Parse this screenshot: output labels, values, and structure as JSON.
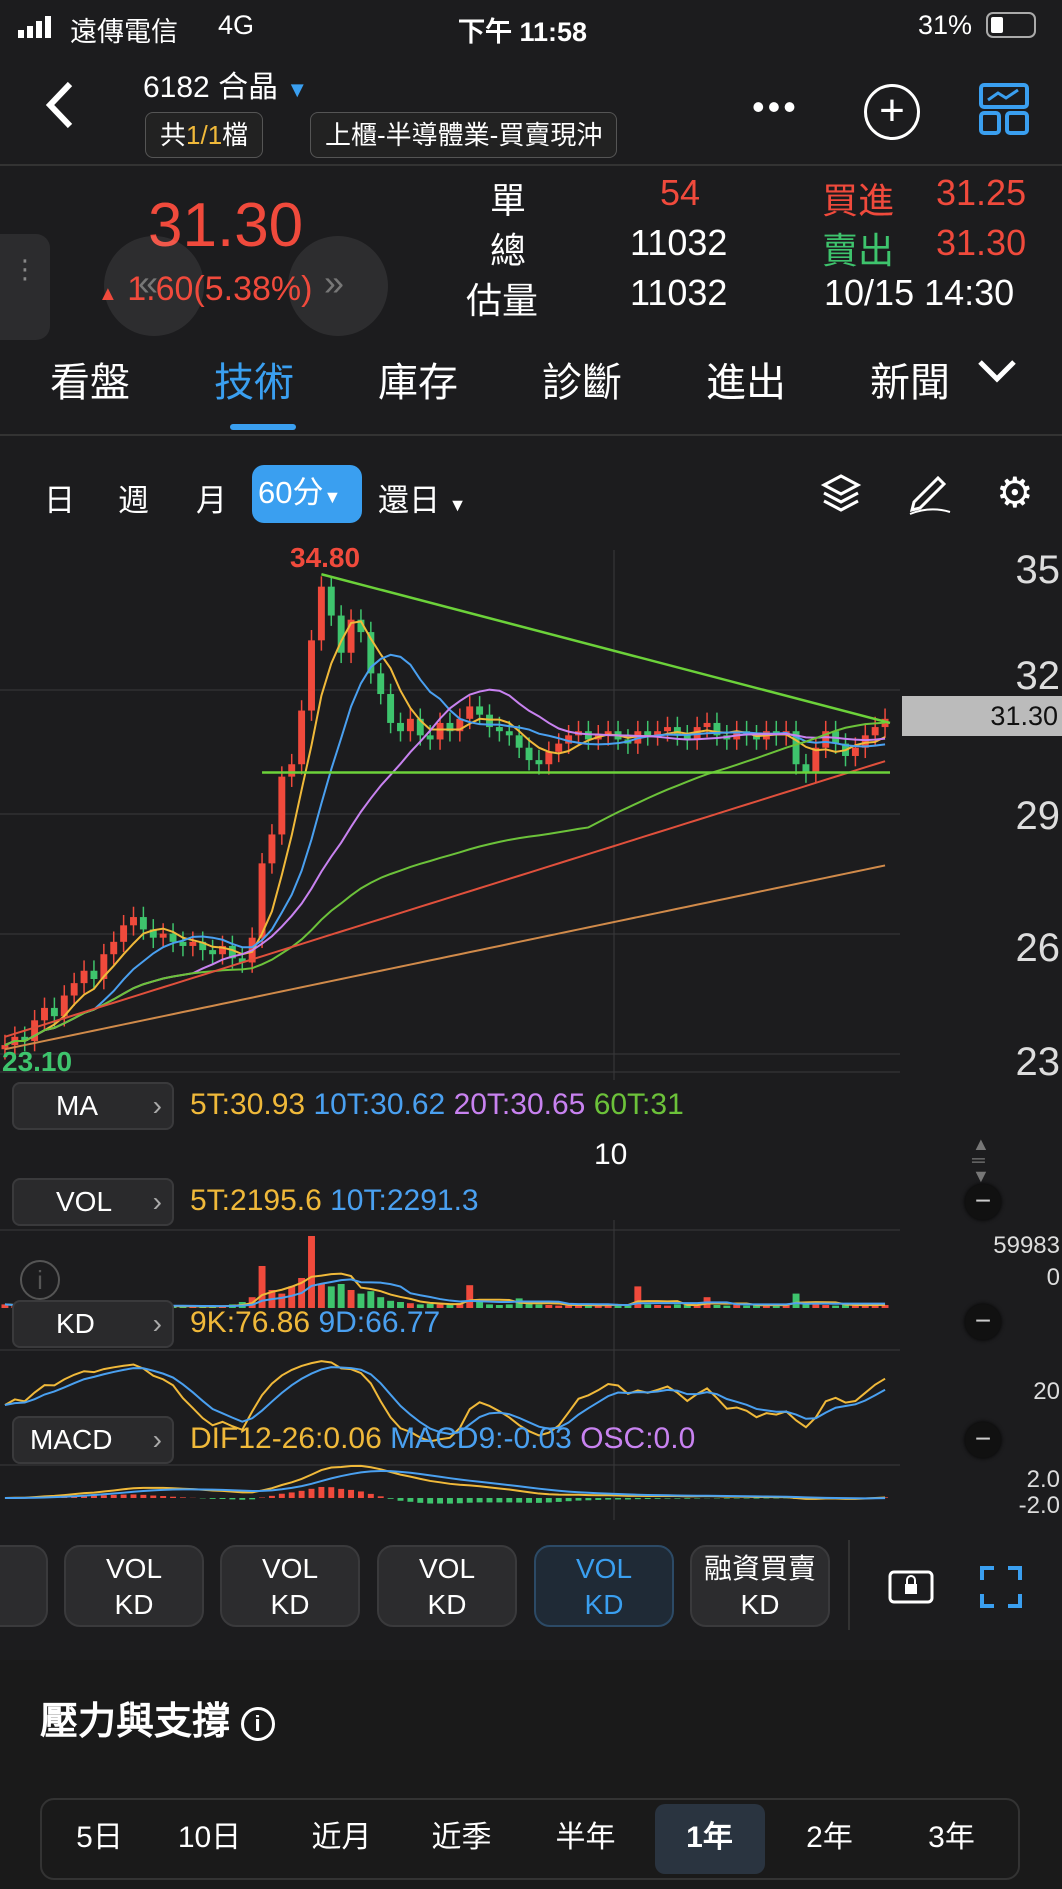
{
  "status": {
    "carrier": "遠傳電信",
    "network": "4G",
    "time": "下午 11:58",
    "battery": "31%"
  },
  "header": {
    "title": "6182 合晶",
    "file_prefix": "共",
    "file_count": "1/1",
    "file_suffix": "檔",
    "market": "上櫃-半導體業-買賣現沖"
  },
  "quote": {
    "price": "31.30",
    "change": "1.60(5.38%)",
    "labels": {
      "single": "單",
      "total": "總",
      "est": "估量",
      "bid": "買進",
      "ask": "賣出"
    },
    "single": "54",
    "total": "11032",
    "est": "11032",
    "bid": "31.25",
    "ask": "31.30",
    "datetime": "10/15 14:30"
  },
  "tabs": [
    "看盤",
    "技術",
    "庫存",
    "診斷",
    "進出",
    "新聞"
  ],
  "toolbar": {
    "periods": [
      "日",
      "週",
      "月",
      "60分"
    ],
    "adjust": "還日"
  },
  "chart_labels": {
    "high": "34.80",
    "low": "23.10",
    "current": "31.30",
    "x_tick": "10",
    "price_ticks": [
      "35",
      "32",
      "29",
      "26",
      "23"
    ],
    "vol_ticks": [
      "59983",
      "0"
    ],
    "kd_tick": "20",
    "macd_ticks": [
      "2.0",
      "-2.0"
    ]
  },
  "ma": {
    "label": "MA",
    "v5": "5T:30.93",
    "v10": "10T:30.62",
    "v20": "20T:30.65",
    "v60": "60T:31"
  },
  "vol": {
    "label": "VOL",
    "v5": "5T:2195.6",
    "v10": "10T:2291.3"
  },
  "kd": {
    "label": "KD",
    "k": "9K:76.86",
    "d": "9D:66.77"
  },
  "macd": {
    "label": "MACD",
    "dif": "DIF12-26:0.06",
    "macd": "MACD9:-0.03",
    "osc": "OSC:0.0"
  },
  "presets": [
    {
      "a": "VOL",
      "b": "KD"
    },
    {
      "a": "VOL",
      "b": "KD"
    },
    {
      "a": "VOL",
      "b": "KD"
    },
    {
      "a": "VOL",
      "b": "KD"
    },
    {
      "a": "融資買賣",
      "b": "KD"
    }
  ],
  "section": {
    "title": "壓力與支撐",
    "periods": [
      "5日",
      "10日",
      "近月",
      "近季",
      "半年",
      "1年",
      "2年",
      "3年"
    ],
    "active": "1年"
  },
  "colors": {
    "up": "#f04a3c",
    "down": "#3ec46d",
    "accent": "#3a9ff0",
    "ma5": "#f0b93a",
    "ma10": "#4aa0f0",
    "ma20": "#c882f0",
    "ma60": "#6cc23a"
  },
  "chart_data": {
    "type": "candlestick",
    "ylim": [
      23,
      35
    ],
    "closes": [
      23.4,
      23.6,
      23.5,
      24.0,
      24.3,
      24.1,
      24.6,
      24.9,
      25.2,
      25.0,
      25.6,
      25.9,
      26.3,
      26.5,
      26.2,
      26.0,
      26.1,
      25.9,
      25.8,
      25.9,
      25.7,
      25.6,
      25.8,
      25.5,
      25.4,
      26.0,
      27.8,
      28.5,
      29.9,
      30.2,
      31.5,
      33.2,
      34.5,
      33.8,
      32.9,
      33.7,
      33.4,
      32.4,
      31.9,
      31.2,
      31.0,
      31.3,
      30.9,
      30.8,
      31.2,
      31.0,
      31.3,
      31.6,
      31.4,
      31.1,
      31.0,
      30.9,
      30.6,
      30.3,
      30.2,
      30.5,
      30.7,
      30.9,
      31.0,
      30.8,
      30.9,
      31.0,
      30.8,
      30.7,
      31.0,
      30.9,
      31.0,
      31.1,
      30.9,
      30.8,
      31.1,
      31.2,
      30.9,
      30.8,
      31.0,
      30.9,
      30.8,
      31.0,
      30.9,
      31.0,
      30.2,
      30.0,
      30.6,
      31.0,
      30.7,
      30.4,
      30.6,
      30.9,
      31.1,
      31.3
    ],
    "volumes": [
      300,
      200,
      150,
      250,
      200,
      150,
      300,
      200,
      150,
      200,
      250,
      200,
      300,
      200,
      150,
      200,
      150,
      100,
      150,
      120,
      100,
      150,
      200,
      300,
      500,
      900,
      3500,
      1500,
      1200,
      1800,
      2500,
      5998,
      2000,
      1800,
      2000,
      1500,
      1200,
      1400,
      900,
      600,
      500,
      400,
      300,
      350,
      300,
      250,
      400,
      1900,
      600,
      300,
      250,
      300,
      800,
      350,
      300,
      250,
      200,
      200,
      300,
      250,
      200,
      250,
      300,
      200,
      1800,
      300,
      250,
      200,
      300,
      250,
      200,
      900,
      250,
      200,
      300,
      200,
      250,
      200,
      300,
      250,
      1200,
      400,
      300,
      250,
      200,
      300,
      200,
      250,
      300,
      250
    ],
    "trendline": {
      "from": 34.8,
      "to": 31.2
    },
    "support": 30.0
  }
}
